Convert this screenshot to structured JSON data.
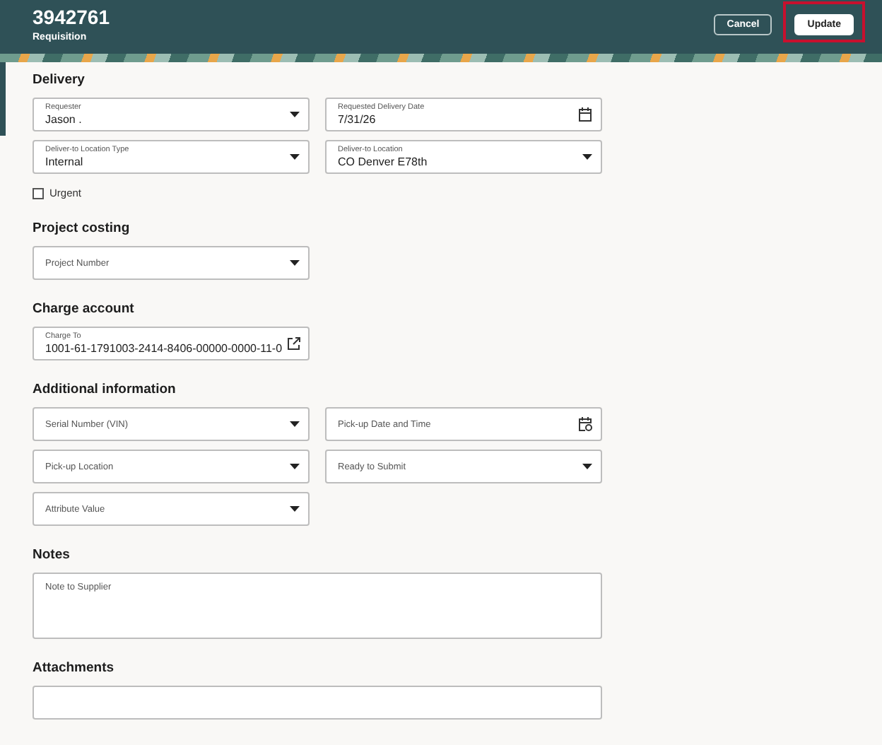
{
  "header": {
    "title": "3942761",
    "subtitle": "Requisition",
    "buttons": [
      {
        "label": "Cancel",
        "kind": "secondary",
        "highlighted": false
      },
      {
        "label": "Update",
        "kind": "primary",
        "highlighted": true
      }
    ]
  },
  "sections": [
    {
      "title": "Delivery",
      "fields": [
        {
          "kind": "select",
          "label": "Requester",
          "value": "Jason ."
        },
        {
          "kind": "date",
          "label": "Requested Delivery Date",
          "value": "7/31/26"
        },
        {
          "kind": "select",
          "label": "Deliver-to Location Type",
          "value": "Internal"
        },
        {
          "kind": "select",
          "label": "Deliver-to Location",
          "value": "CO Denver E78th"
        }
      ],
      "checkboxes": [
        {
          "label": "Urgent",
          "checked": false
        }
      ]
    },
    {
      "title": "Project costing",
      "fields": [
        {
          "kind": "select",
          "label": "Project Number"
        }
      ]
    },
    {
      "title": "Charge account",
      "fields": [
        {
          "kind": "link",
          "label": "Charge To",
          "value": "1001-61-1791003-2414-8406-00000-0000-11-0"
        }
      ]
    },
    {
      "title": "Additional information",
      "fields": [
        {
          "kind": "select",
          "label": "Serial Number (VIN)"
        },
        {
          "kind": "datetime",
          "label": "Pick-up Date and Time"
        },
        {
          "kind": "select",
          "label": "Pick-up Location"
        },
        {
          "kind": "select",
          "label": "Ready to Submit"
        },
        {
          "kind": "select",
          "label": "Attribute Value"
        }
      ]
    },
    {
      "title": "Notes",
      "fields": [
        {
          "kind": "textarea",
          "label": "Note to Supplier"
        }
      ]
    },
    {
      "title": "Attachments",
      "fields": [
        {
          "kind": "cut"
        }
      ]
    }
  ]
}
